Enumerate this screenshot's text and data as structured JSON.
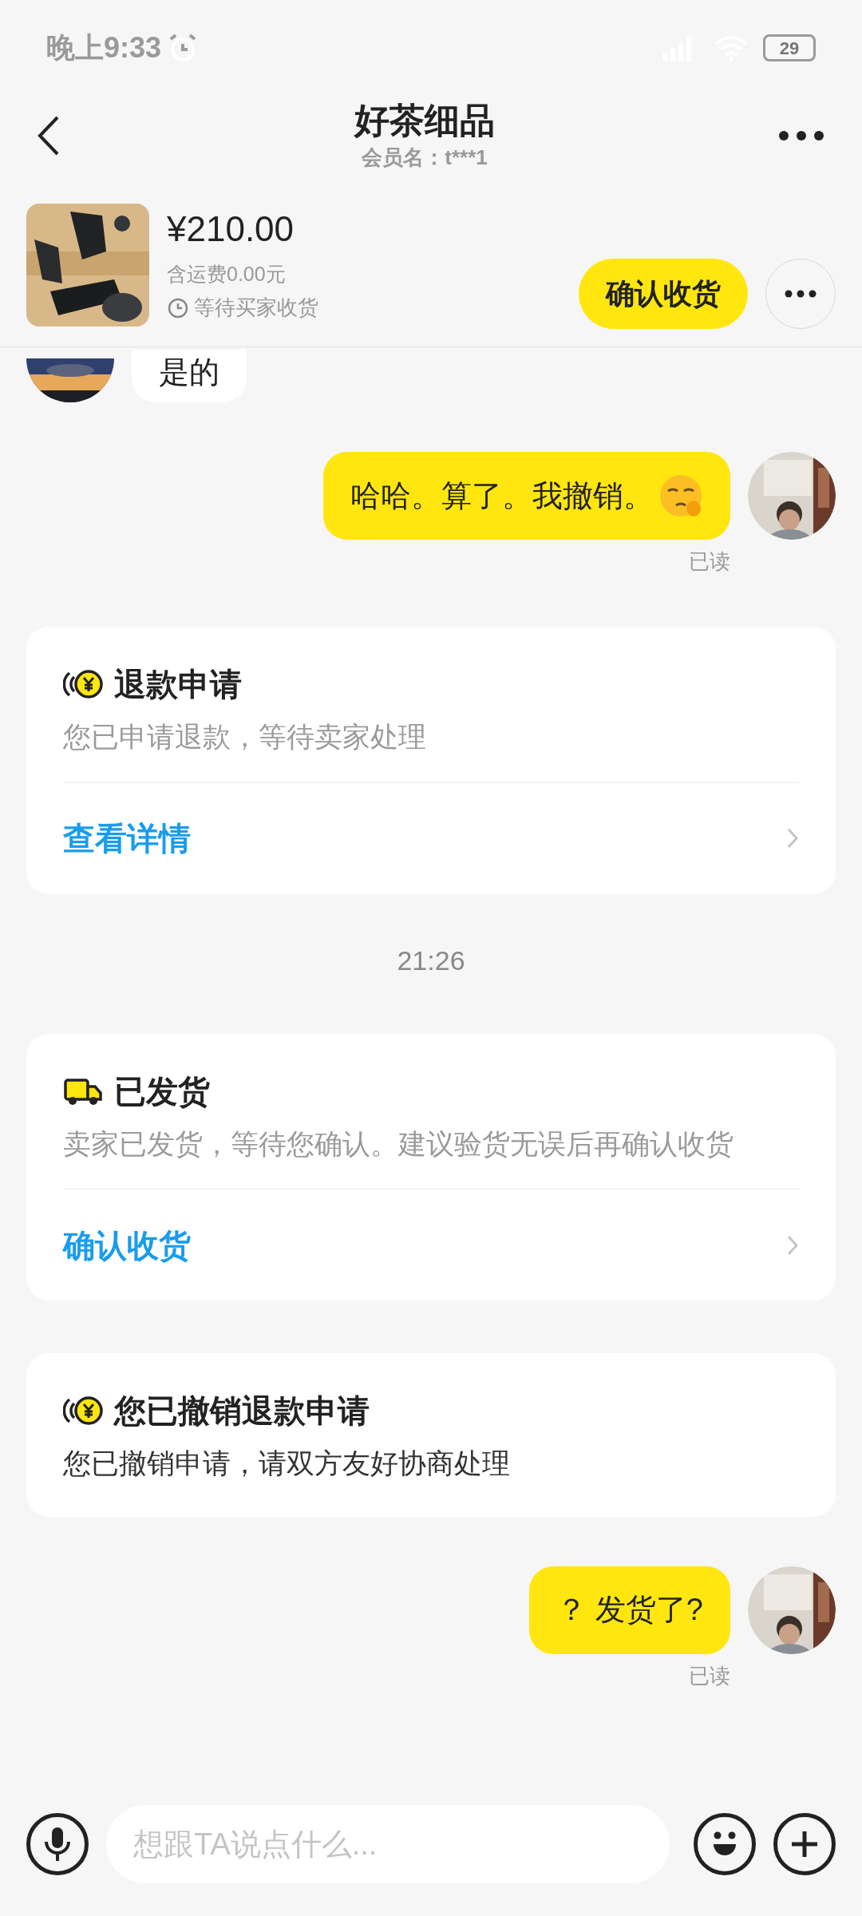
{
  "status_bar": {
    "time": "晚上9:33",
    "battery": "29"
  },
  "header": {
    "title": "好茶细品",
    "subtitle": "会员名：t***1"
  },
  "order": {
    "price": "¥210.00",
    "shipping": "含运费0.00元",
    "status": "等待买家收货",
    "confirm_button": "确认收货"
  },
  "messages": [
    {
      "kind": "incoming",
      "text": "是的"
    },
    {
      "kind": "outgoing",
      "text": "哈哈。算了。我撤销。",
      "emoji": true,
      "receipt": "已读"
    },
    {
      "kind": "refund-card",
      "title": "退款申请",
      "body": "您已申请退款，等待卖家处理",
      "link": "查看详情"
    },
    {
      "kind": "time",
      "text": "21:26"
    },
    {
      "kind": "shipping-card",
      "title": "已发货",
      "body": "卖家已发货，等待您确认。建议验货无误后再确认收货",
      "link": "确认收货"
    },
    {
      "kind": "refund-card",
      "title": "您已撤销退款申请",
      "body": "您已撤销申请，请双方友好协商处理"
    },
    {
      "kind": "outgoing",
      "text": "？ 发货了?",
      "emoji": false,
      "receipt": "已读"
    }
  ],
  "input": {
    "placeholder": "想跟TA说点什么..."
  }
}
